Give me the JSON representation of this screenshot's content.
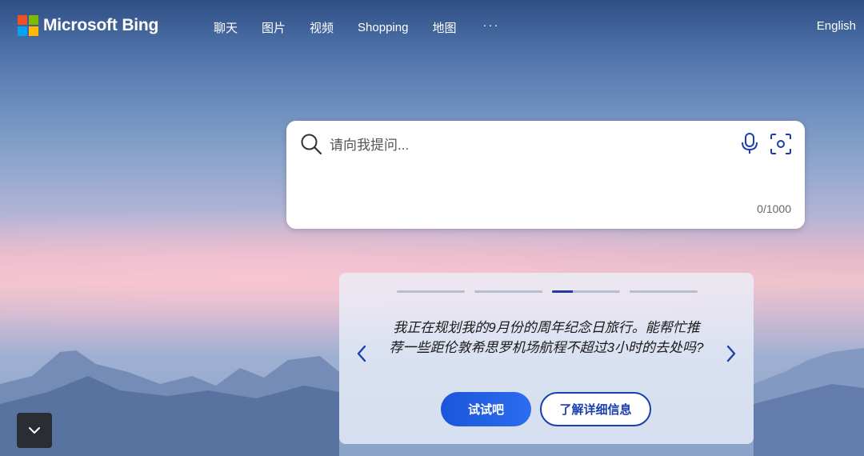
{
  "brand": {
    "name": "Microsoft Bing",
    "logo_colors": [
      "#f25022",
      "#7fba00",
      "#00a4ef",
      "#ffb900"
    ]
  },
  "nav": {
    "items": [
      {
        "label": "聊天"
      },
      {
        "label": "图片"
      },
      {
        "label": "视频"
      },
      {
        "label": "Shopping"
      },
      {
        "label": "地图"
      }
    ],
    "more_label": "···",
    "language": "English"
  },
  "search": {
    "placeholder": "请向我提问...",
    "value": "",
    "char_count": "0/1000",
    "icons": [
      "search-icon",
      "microphone-icon",
      "visual-search-icon"
    ]
  },
  "suggestion_card": {
    "progress": [
      0,
      0,
      0.3,
      0
    ],
    "active_index": 2,
    "text": "我正在规划我的9月份的周年纪念日旅行。能帮忙推荐一些距伦敦希思罗机场航程不超过3小时的去处吗?",
    "try_label": "试试吧",
    "learn_more_label": "了解详细信息",
    "icons": [
      "chevron-left-icon",
      "chevron-right-icon"
    ]
  },
  "scroll_down": {
    "icon": "chevron-down-icon"
  },
  "colors": {
    "accent": "#1a56d9",
    "accent_dark": "#1a3fae",
    "progress_active": "#1f3d99"
  }
}
